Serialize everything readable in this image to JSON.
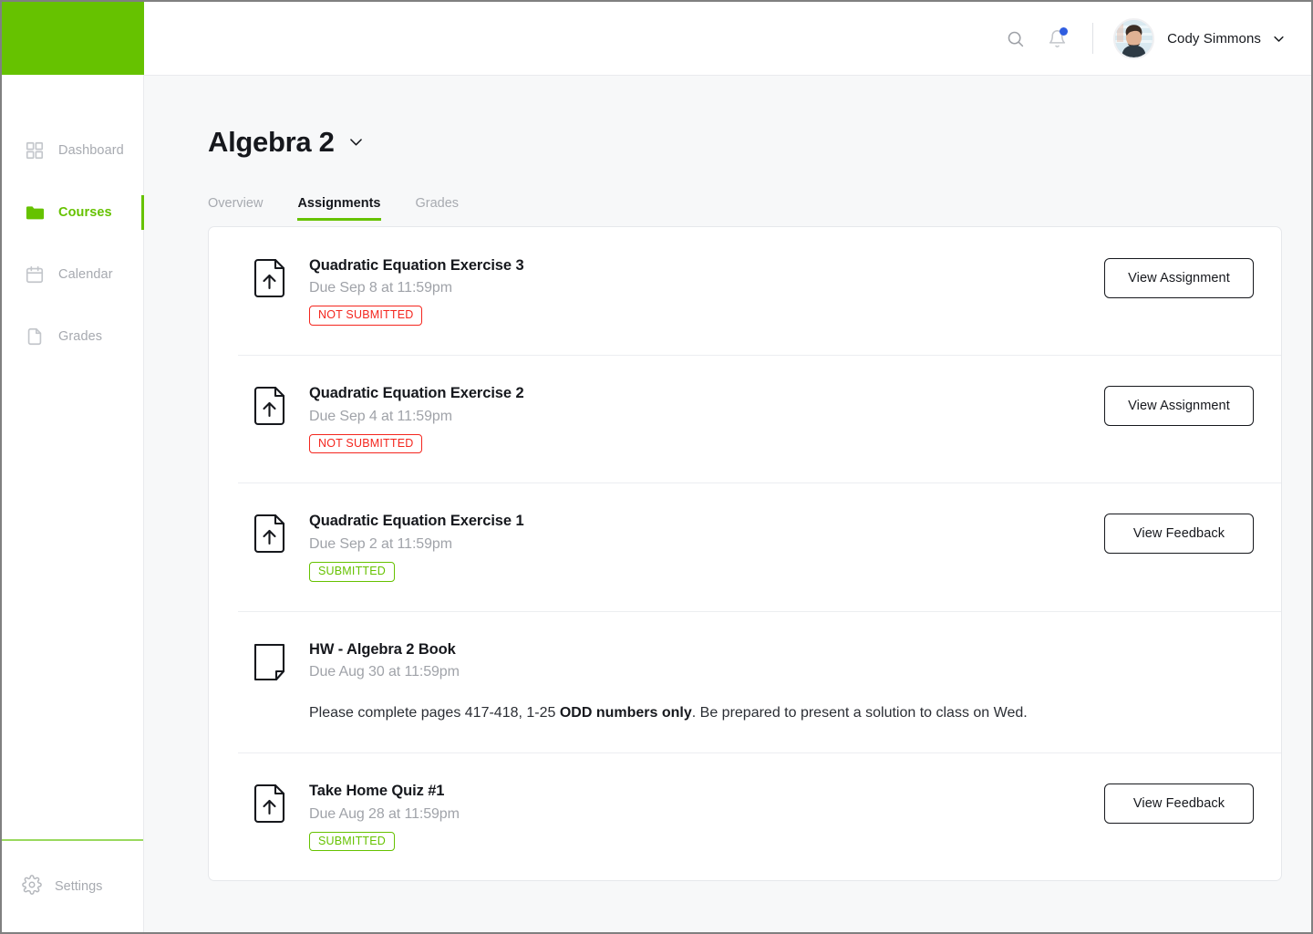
{
  "brand": {
    "accent_color": "#66c200",
    "logo_block": "brand-logo-block"
  },
  "sidebar": {
    "items": [
      {
        "label": "Dashboard",
        "icon": "dashboard-grid-icon",
        "active": false
      },
      {
        "label": "Courses",
        "icon": "folder-icon",
        "active": true
      },
      {
        "label": "Calendar",
        "icon": "calendar-icon",
        "active": false
      },
      {
        "label": "Grades",
        "icon": "document-icon",
        "active": false
      }
    ],
    "bottom": {
      "label": "Settings",
      "icon": "gear-icon"
    }
  },
  "topbar": {
    "search_icon": "search-icon",
    "notifications_icon": "bell-icon",
    "notification_dot_color": "#2f5de0",
    "user": {
      "name": "Cody Simmons",
      "avatar": "user-avatar-photo",
      "caret": "chevron-down-icon"
    }
  },
  "header": {
    "course_title": "Algebra 2",
    "course_caret": "chevron-down-icon",
    "tabs": [
      {
        "label": "Overview",
        "active": false
      },
      {
        "label": "Assignments",
        "active": true
      },
      {
        "label": "Grades",
        "active": false
      }
    ]
  },
  "assignments": [
    {
      "icon": "document-upload-icon",
      "title": "Quadratic Equation Exercise 3",
      "due": "Due Sep 8 at 11:59pm",
      "status": "NOT SUBMITTED",
      "status_type": "red",
      "action": "View Assignment",
      "description": null,
      "description_bold": null,
      "description_tail": null
    },
    {
      "icon": "document-upload-icon",
      "title": "Quadratic Equation Exercise 2",
      "due": "Due Sep 4 at 11:59pm",
      "status": "NOT SUBMITTED",
      "status_type": "red",
      "action": "View Assignment",
      "description": null,
      "description_bold": null,
      "description_tail": null
    },
    {
      "icon": "document-upload-icon",
      "title": "Quadratic Equation Exercise 1",
      "due": "Due Sep 2 at 11:59pm",
      "status": "SUBMITTED",
      "status_type": "green",
      "action": "View Feedback",
      "description": null,
      "description_bold": null,
      "description_tail": null
    },
    {
      "icon": "document-plain-icon",
      "title": "HW - Algebra 2 Book",
      "due": "Due Aug 30 at 11:59pm",
      "status": null,
      "status_type": null,
      "action": null,
      "description": "Please complete pages 417-418, 1-25 ",
      "description_bold": "ODD numbers only",
      "description_tail": ". Be prepared to present a solution to class on Wed."
    },
    {
      "icon": "document-upload-icon",
      "title": "Take Home Quiz #1",
      "due": "Due Aug 28 at 11:59pm",
      "status": "SUBMITTED",
      "status_type": "green",
      "action": "View Feedback",
      "description": null,
      "description_bold": null,
      "description_tail": null
    }
  ]
}
